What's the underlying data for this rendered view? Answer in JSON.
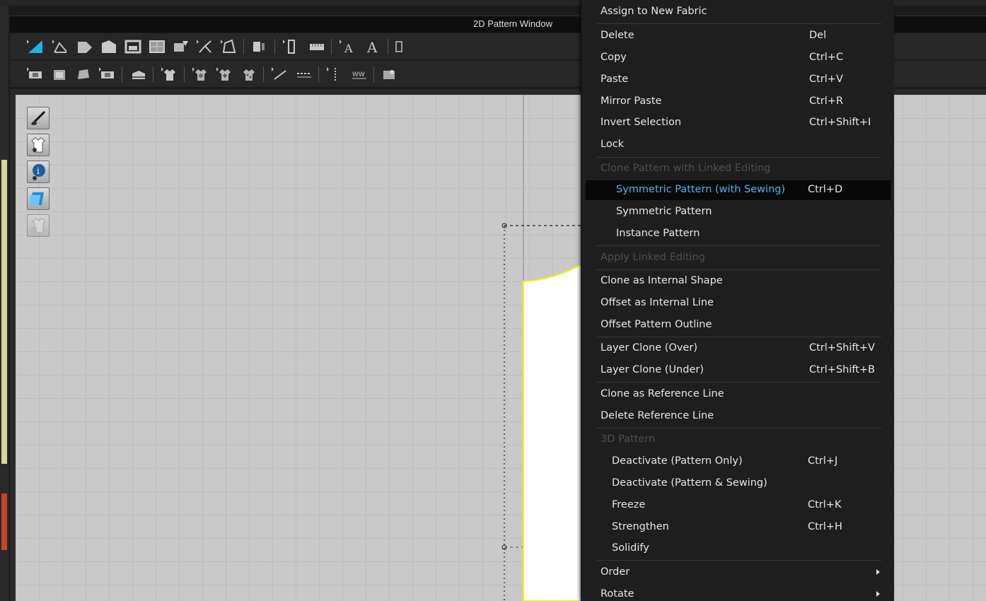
{
  "window": {
    "title": "2D Pattern Window"
  },
  "side_tools": [
    {
      "icon": "pen-eye-icon"
    },
    {
      "icon": "shirt-eye-icon"
    },
    {
      "icon": "info-eye-icon"
    },
    {
      "icon": "fabric-layer-icon"
    },
    {
      "icon": "locked-shirt-icon"
    }
  ],
  "colors": {
    "highlight_text": "#4fb6ee",
    "accent_cyan": "#19b5e8",
    "pattern_outline": "#f4f400",
    "canvas": "#c9c9c9"
  },
  "menu": {
    "assign_new_fabric": "Assign to New Fabric",
    "delete": {
      "label": "Delete",
      "shortcut": "Del"
    },
    "copy": {
      "label": "Copy",
      "shortcut": "Ctrl+C"
    },
    "paste": {
      "label": "Paste",
      "shortcut": "Ctrl+V"
    },
    "mirror_paste": {
      "label": "Mirror Paste",
      "shortcut": "Ctrl+R"
    },
    "invert_selection": {
      "label": "Invert Selection",
      "shortcut": "Ctrl+Shift+I"
    },
    "lock": {
      "label": "Lock"
    },
    "clone_linked_header": "Clone Pattern with Linked Editing",
    "symmetric_sewing": {
      "label": "Symmetric Pattern (with Sewing)",
      "shortcut": "Ctrl+D"
    },
    "symmetric": {
      "label": "Symmetric Pattern"
    },
    "instance": {
      "label": "Instance Pattern"
    },
    "apply_linked": "Apply Linked Editing",
    "clone_internal_shape": "Clone as Internal Shape",
    "offset_internal_line": "Offset as Internal Line",
    "offset_outline": "Offset Pattern Outline",
    "layer_clone_over": {
      "label": "Layer Clone (Over)",
      "shortcut": "Ctrl+Shift+V"
    },
    "layer_clone_under": {
      "label": "Layer Clone (Under)",
      "shortcut": "Ctrl+Shift+B"
    },
    "clone_reference": "Clone as Reference Line",
    "delete_reference": "Delete Reference Line",
    "pattern3d_header": "3D Pattern",
    "deactivate_pattern_only": {
      "label": "Deactivate (Pattern Only)",
      "shortcut": "Ctrl+J"
    },
    "deactivate_pattern_sewing": {
      "label": "Deactivate (Pattern & Sewing)"
    },
    "freeze": {
      "label": "Freeze",
      "shortcut": "Ctrl+K"
    },
    "strengthen": {
      "label": "Strengthen",
      "shortcut": "Ctrl+H"
    },
    "solidify": {
      "label": "Solidify"
    },
    "order": {
      "label": "Order"
    },
    "rotate": {
      "label": "Rotate"
    }
  }
}
